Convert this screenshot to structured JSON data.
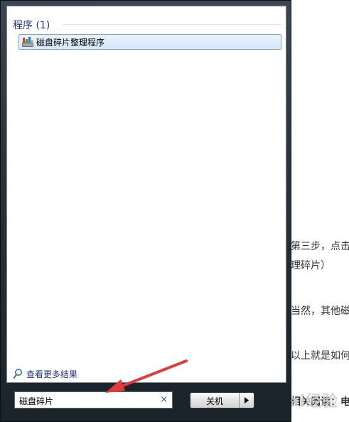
{
  "article": {
    "lines": [
      "第三步，点击",
      "理碎片）",
      "当然，其他磁",
      "以上就是如何",
      "相关阅读：电"
    ]
  },
  "watermark": {
    "text": "Bai经验"
  },
  "start_menu": {
    "group_header": "程序 (1)",
    "results": [
      {
        "label": "磁盘碎片整理程序",
        "icon": "defrag-app-icon"
      }
    ],
    "more_results": {
      "label": "查看更多结果",
      "icon": "search-icon"
    },
    "search": {
      "value": "磁盘碎片",
      "clear_symbol": "×"
    },
    "shutdown": {
      "label": "关机"
    }
  },
  "colors": {
    "header_text": "#1e3287",
    "highlight_border": "#7da2ce",
    "annotation_arrow": "#e23b3b",
    "frame_dark": "#1b232a"
  }
}
